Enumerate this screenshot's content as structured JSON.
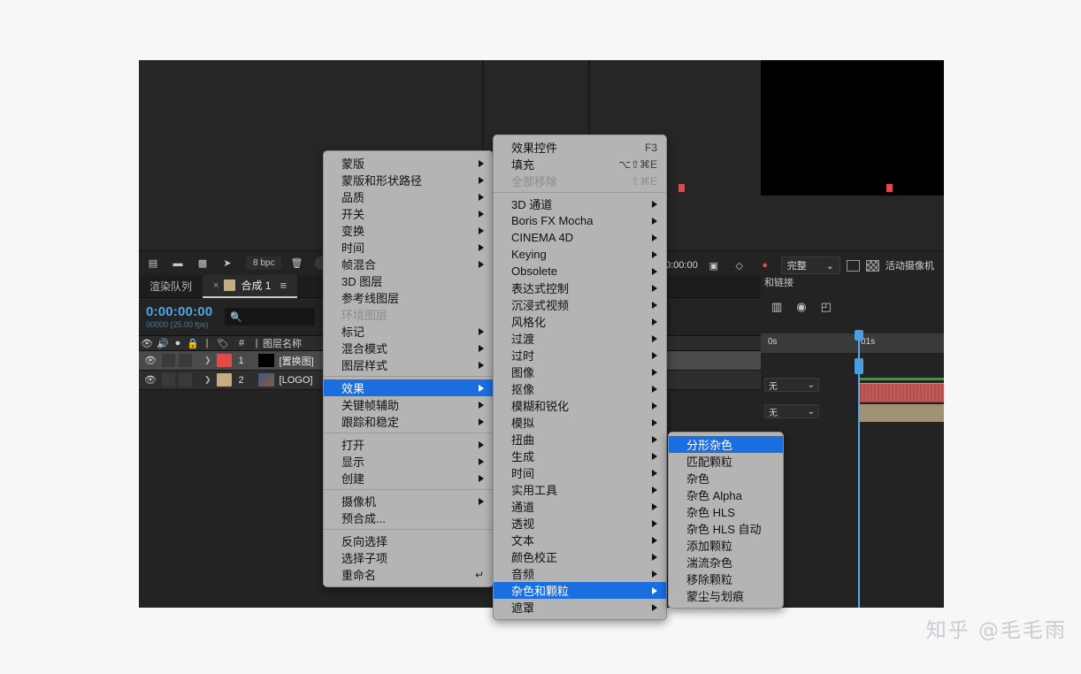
{
  "app": {
    "toolbar": {
      "icons": [
        "render-queue-icon",
        "folder-icon",
        "composition-icon",
        "rocket-icon"
      ],
      "bit_depth": "8 bpc",
      "trash_label": "trash-icon",
      "timecode": "0:00:00",
      "quality_label": "完整",
      "camera_label": "活动摄像机"
    },
    "timeline": {
      "tabs": [
        {
          "label": "渲染队列",
          "active": false
        },
        {
          "label": "合成 1",
          "active": true
        }
      ],
      "close_glyph": "×",
      "menu_glyph": "≡",
      "current_time": "0:00:00:00",
      "frame_info": "00000 (25.00 fps)",
      "search_placeholder": "",
      "columns": [
        "图层名称"
      ],
      "hash_header": "#",
      "parent_header": "和链接",
      "layers": [
        {
          "index": "1",
          "name": "[置换图]",
          "color": "#e04a4a",
          "selected": true,
          "parent": "无"
        },
        {
          "index": "2",
          "name": "[LOGO]",
          "color": "#c6ac82",
          "selected": false,
          "parent": "无"
        }
      ],
      "ruler_labels": [
        "0s",
        "01s"
      ]
    }
  },
  "menu_layer": {
    "items": [
      {
        "label": "蒙版",
        "submenu": true
      },
      {
        "label": "蒙版和形状路径",
        "submenu": true
      },
      {
        "label": "品质",
        "submenu": true
      },
      {
        "label": "开关",
        "submenu": true
      },
      {
        "label": "变换",
        "submenu": true
      },
      {
        "label": "时间",
        "submenu": true
      },
      {
        "label": "帧混合",
        "submenu": true
      },
      {
        "label": "3D 图层",
        "submenu": false
      },
      {
        "label": "参考线图层",
        "submenu": false
      },
      {
        "label": "环境图层",
        "submenu": false,
        "disabled": true
      },
      {
        "label": "标记",
        "submenu": true
      },
      {
        "label": "混合模式",
        "submenu": true
      },
      {
        "label": "图层样式",
        "submenu": true
      },
      {
        "separator": true
      },
      {
        "label": "效果",
        "submenu": true,
        "highlighted": true
      },
      {
        "label": "关键帧辅助",
        "submenu": true
      },
      {
        "label": "跟踪和稳定",
        "submenu": true
      },
      {
        "separator": true
      },
      {
        "label": "打开",
        "submenu": true
      },
      {
        "label": "显示",
        "submenu": true
      },
      {
        "label": "创建",
        "submenu": true
      },
      {
        "separator": true
      },
      {
        "label": "摄像机",
        "submenu": true
      },
      {
        "label": "预合成...",
        "submenu": false
      },
      {
        "separator": true
      },
      {
        "label": "反向选择",
        "submenu": false
      },
      {
        "label": "选择子项",
        "submenu": false
      },
      {
        "label": "重命名",
        "submenu": false,
        "return_icon": "↵"
      }
    ]
  },
  "menu_effect": {
    "items": [
      {
        "label": "效果控件",
        "shortcut": "F3"
      },
      {
        "label": "填充",
        "shortcut": "⌥⇧⌘E"
      },
      {
        "label": "全部移除",
        "shortcut": "⇧⌘E",
        "disabled": true
      },
      {
        "separator": true
      },
      {
        "label": "3D 通道",
        "submenu": true
      },
      {
        "label": "Boris FX Mocha",
        "submenu": true
      },
      {
        "label": "CINEMA 4D",
        "submenu": true
      },
      {
        "label": "Keying",
        "submenu": true
      },
      {
        "label": "Obsolete",
        "submenu": true
      },
      {
        "label": "表达式控制",
        "submenu": true
      },
      {
        "label": "沉浸式视频",
        "submenu": true
      },
      {
        "label": "风格化",
        "submenu": true
      },
      {
        "label": "过渡",
        "submenu": true
      },
      {
        "label": "过时",
        "submenu": true
      },
      {
        "label": "图像",
        "submenu": true
      },
      {
        "label": "抠像",
        "submenu": true
      },
      {
        "label": "模糊和锐化",
        "submenu": true
      },
      {
        "label": "模拟",
        "submenu": true
      },
      {
        "label": "扭曲",
        "submenu": true
      },
      {
        "label": "生成",
        "submenu": true
      },
      {
        "label": "时间",
        "submenu": true
      },
      {
        "label": "实用工具",
        "submenu": true
      },
      {
        "label": "通道",
        "submenu": true
      },
      {
        "label": "透视",
        "submenu": true
      },
      {
        "label": "文本",
        "submenu": true
      },
      {
        "label": "颜色校正",
        "submenu": true
      },
      {
        "label": "音频",
        "submenu": true
      },
      {
        "label": "杂色和颗粒",
        "submenu": true,
        "highlighted": true
      },
      {
        "label": "遮罩",
        "submenu": true
      }
    ]
  },
  "menu_noise": {
    "items": [
      {
        "label": "分形杂色",
        "highlighted": true
      },
      {
        "label": "匹配颗粒"
      },
      {
        "label": "杂色"
      },
      {
        "label": "杂色 Alpha"
      },
      {
        "label": "杂色 HLS"
      },
      {
        "label": "杂色 HLS 自动"
      },
      {
        "label": "添加颗粒"
      },
      {
        "label": "湍流杂色"
      },
      {
        "label": "移除颗粒"
      },
      {
        "label": "蒙尘与划痕"
      }
    ]
  },
  "watermark": {
    "text": "知乎 @毛毛雨"
  },
  "colors": {
    "menu_bg": "#b4b4b4",
    "highlight": "#1a6ee0",
    "accent_blue": "#4ca8e0",
    "layer1": "#e04a4a",
    "layer2": "#c6ac82"
  }
}
